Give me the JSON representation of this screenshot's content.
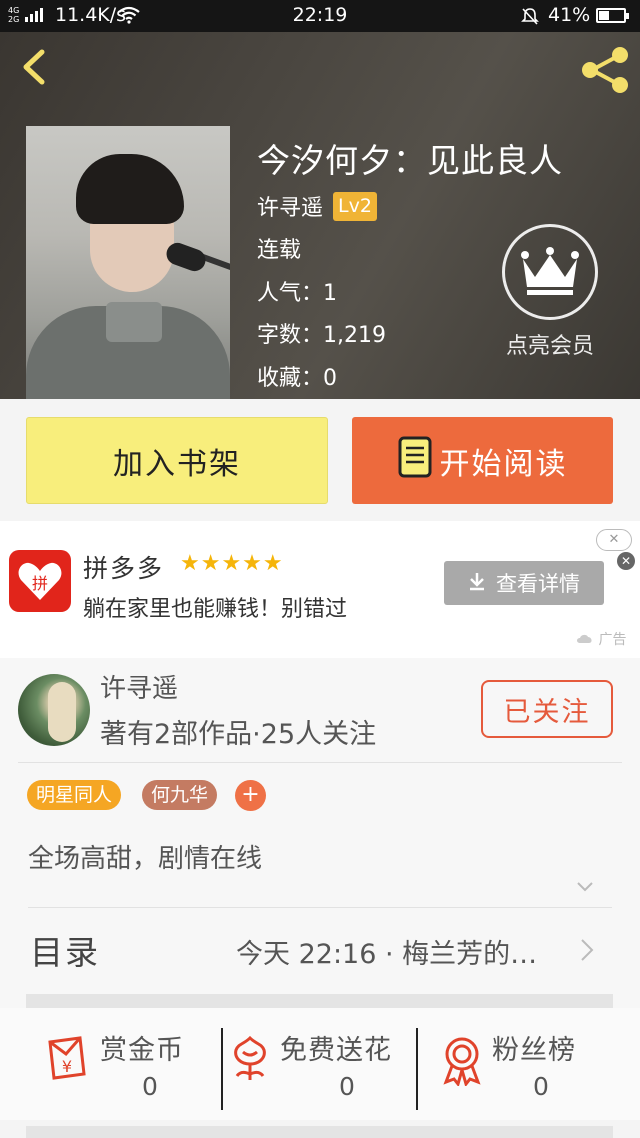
{
  "status_bar": {
    "net_top": "4G",
    "net_bottom": "2G",
    "speed": "11.4K/s",
    "time": "22:19",
    "battery": "41%",
    "battery_level": 0.41
  },
  "book": {
    "title": "今汐何夕：见此良人",
    "author": "许寻遥",
    "level": "Lv2",
    "status": "连载",
    "popularity": "人气：1",
    "word_count": "字数：1,219",
    "favorites": "收藏：0"
  },
  "vip": {
    "label": "点亮会员"
  },
  "actions": {
    "add_shelf": "加入书架",
    "start_reading": "开始阅读"
  },
  "ad": {
    "name": "拼多多",
    "logo_text": "拼",
    "stars": "★★★★★",
    "slogan": "躺在家里也能赚钱！别错过",
    "detail_button": "查看详情",
    "tag": "广告",
    "close": "✕"
  },
  "author_section": {
    "name": "许寻遥",
    "stats": "著有2部作品·25人关注",
    "follow_button": "已关注",
    "tags": [
      "明星同人",
      "何九华"
    ],
    "add_tag": "+",
    "intro": "全场高甜，剧情在线"
  },
  "toc": {
    "label": "目录",
    "latest": "今天 22:16 · 梅兰芳的…"
  },
  "rewards": [
    {
      "label": "赏金币",
      "value": "0",
      "icon": "red-envelope-icon"
    },
    {
      "label": "免费送花",
      "value": "0",
      "icon": "flower-icon"
    },
    {
      "label": "粉丝榜",
      "value": "0",
      "icon": "medal-icon"
    }
  ],
  "colors": {
    "accent_orange": "#ed6a3d",
    "shelf_yellow": "#f8ee7c",
    "level_badge": "#f0b436",
    "icon_red": "#e0432b"
  }
}
